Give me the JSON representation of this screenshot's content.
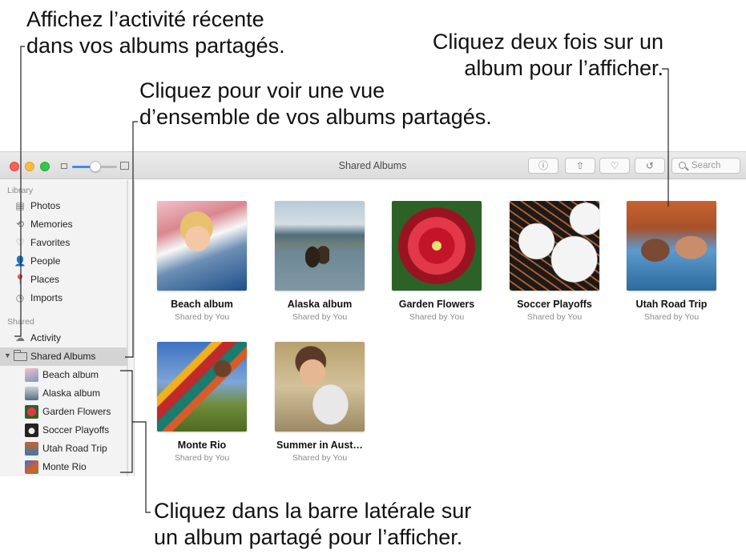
{
  "callouts": {
    "activity": [
      "Affichez l’activité récente",
      "dans vos albums partagés."
    ],
    "overview": [
      "Cliquez pour voir une vue",
      "d’ensemble de vos albums partagés."
    ],
    "double_click": [
      "Cliquez deux fois sur un",
      "album pour l’afficher."
    ],
    "sidebar": [
      "Cliquez dans la barre latérale sur",
      "un album partagé pour l’afficher."
    ]
  },
  "window": {
    "title": "Shared Albums",
    "toolbar": {
      "info_glyph": "ⓘ",
      "share_glyph": "⇧",
      "favorite_glyph": "♡",
      "rotate_glyph": "↺",
      "search_placeholder": "Search"
    }
  },
  "sidebar": {
    "library_header": "Library",
    "library_items": [
      {
        "label": "Photos",
        "icon": "photos-icon",
        "glyph": "▤"
      },
      {
        "label": "Memories",
        "icon": "memories-icon",
        "glyph": "⟲"
      },
      {
        "label": "Favorites",
        "icon": "heart-icon",
        "glyph": "♡"
      },
      {
        "label": "People",
        "icon": "person-icon",
        "glyph": "👤"
      },
      {
        "label": "Places",
        "icon": "pin-icon",
        "glyph": "📍"
      },
      {
        "label": "Imports",
        "icon": "clock-icon",
        "glyph": "◷"
      }
    ],
    "shared_header": "Shared",
    "activity": {
      "label": "Activity",
      "icon": "cloud-icon",
      "glyph": "☁"
    },
    "shared_albums": {
      "label": "Shared Albums",
      "disclosure": "▼"
    },
    "albums": [
      {
        "label": "Beach album"
      },
      {
        "label": "Alaska album"
      },
      {
        "label": "Garden Flowers"
      },
      {
        "label": "Soccer Playoffs"
      },
      {
        "label": "Utah Road Trip"
      },
      {
        "label": "Monte Rio"
      }
    ]
  },
  "grid": [
    {
      "name": "Beach album",
      "sub": "Shared by You"
    },
    {
      "name": "Alaska album",
      "sub": "Shared by You"
    },
    {
      "name": "Garden Flowers",
      "sub": "Shared by You"
    },
    {
      "name": "Soccer Playoffs",
      "sub": "Shared by You"
    },
    {
      "name": "Utah Road Trip",
      "sub": "Shared by You"
    },
    {
      "name": "Monte Rio",
      "sub": "Shared by You"
    },
    {
      "name": "Summer in Aust…",
      "sub": "Shared by You"
    }
  ]
}
